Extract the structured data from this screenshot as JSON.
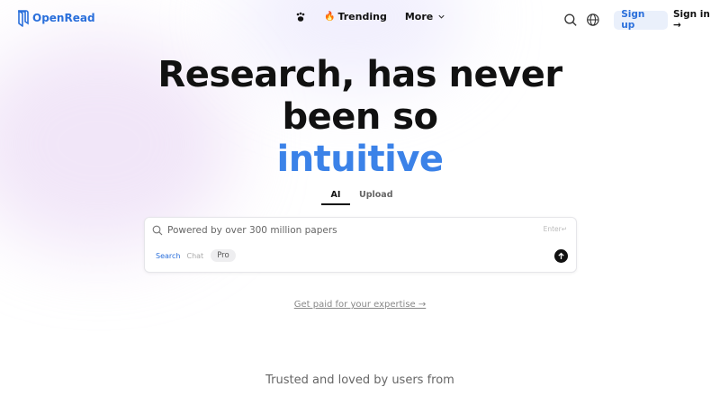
{
  "header": {
    "logo_text": "OpenRead",
    "nav": {
      "trending_label": "Trending",
      "more_label": "More"
    },
    "signup_label": "Sign up",
    "signin_label": "Sign in →"
  },
  "hero": {
    "line1": "Research, has never",
    "line2": "been so",
    "accent": "intuitive"
  },
  "tabs": [
    {
      "label": "AI",
      "active": true
    },
    {
      "label": "Upload",
      "active": false
    }
  ],
  "search": {
    "placeholder": "Powered by over 300 million papers",
    "enter_hint": "Enter↵",
    "modes": {
      "search": "Search",
      "chat": "Chat",
      "pro": "Pro"
    }
  },
  "paid_link": "Get paid for your expertise →",
  "trusted": "Trusted and loved by users from",
  "colors": {
    "accent": "#3b82e8",
    "brand": "#2a6fdb"
  }
}
